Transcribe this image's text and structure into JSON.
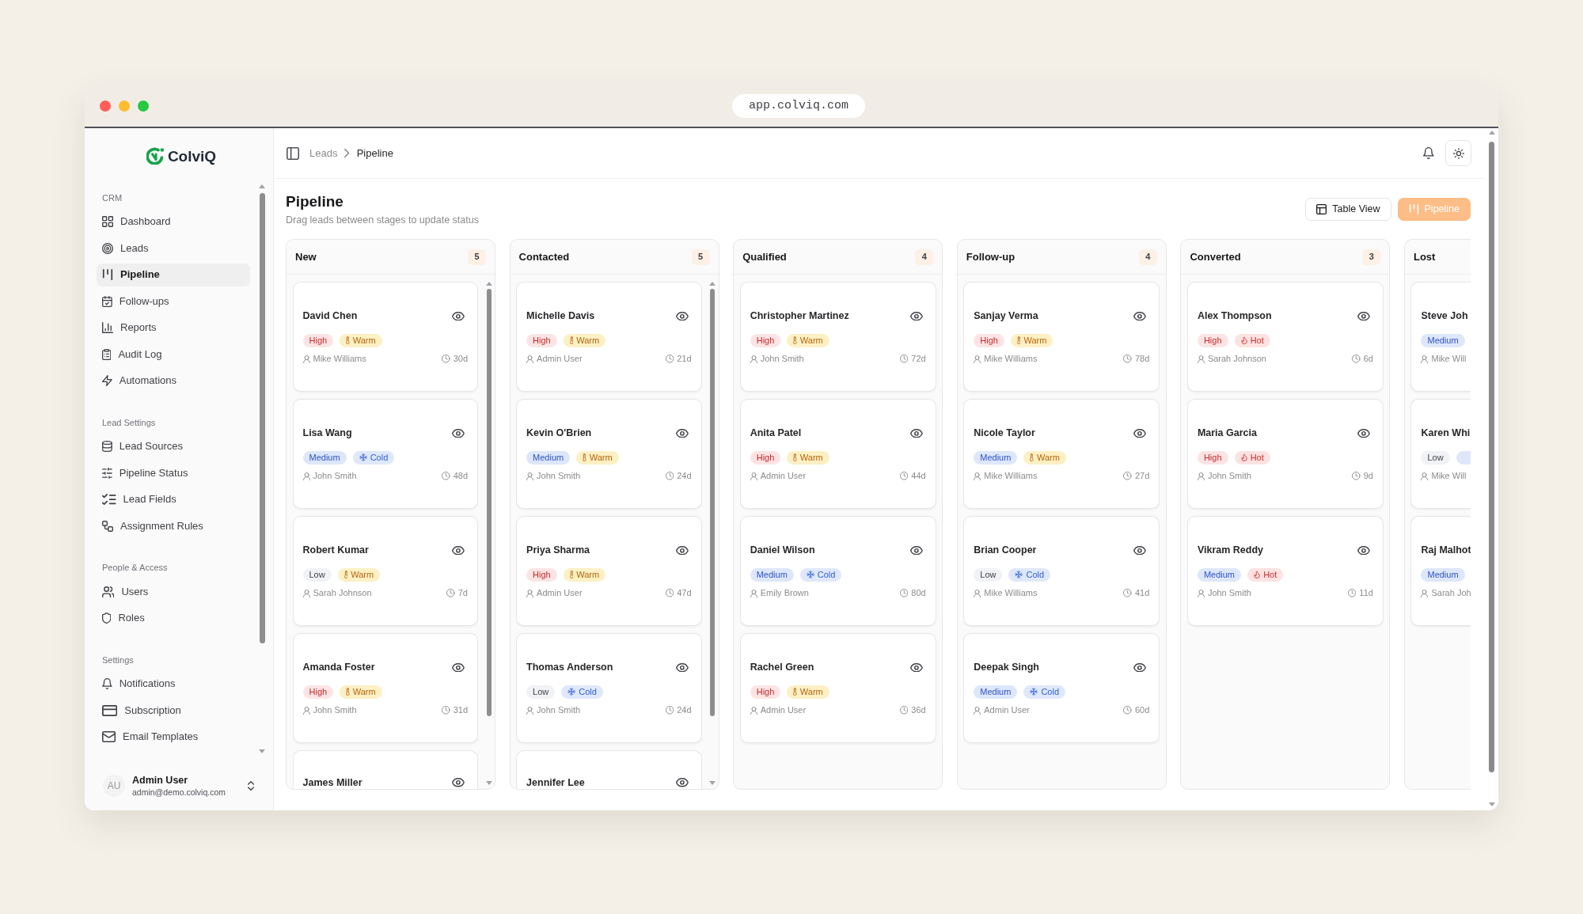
{
  "browser": {
    "url": "app.colviq.com"
  },
  "sidebar": {
    "brand": "ColviQ",
    "sections": [
      {
        "title": "CRM",
        "items": [
          {
            "label": "Dashboard",
            "selected": false
          },
          {
            "label": "Leads",
            "selected": false
          },
          {
            "label": "Pipeline",
            "selected": true
          },
          {
            "label": "Follow-ups",
            "selected": false
          },
          {
            "label": "Reports",
            "selected": false
          },
          {
            "label": "Audit Log",
            "selected": false
          },
          {
            "label": "Automations",
            "selected": false
          }
        ]
      },
      {
        "title": "Lead Settings",
        "items": [
          {
            "label": "Lead Sources",
            "selected": false
          },
          {
            "label": "Pipeline Status",
            "selected": false
          },
          {
            "label": "Lead Fields",
            "selected": false
          },
          {
            "label": "Assignment Rules",
            "selected": false
          }
        ]
      },
      {
        "title": "People & Access",
        "items": [
          {
            "label": "Users",
            "selected": false
          },
          {
            "label": "Roles",
            "selected": false
          }
        ]
      },
      {
        "title": "Settings",
        "items": [
          {
            "label": "Notifications",
            "selected": false
          },
          {
            "label": "Subscription",
            "selected": false
          },
          {
            "label": "Email Templates",
            "selected": false
          }
        ]
      }
    ],
    "user": {
      "initials": "AU",
      "name": "Admin User",
      "email": "admin@demo.colviq.com"
    }
  },
  "topbar": {
    "breadcrumb": [
      {
        "label": "Leads",
        "current": false
      },
      {
        "label": "Pipeline",
        "current": true
      }
    ]
  },
  "header": {
    "title": "Pipeline",
    "subtitle": "Drag leads between stages to update status",
    "view_buttons": [
      {
        "label": "Table View",
        "selected": false
      },
      {
        "label": "Pipeline",
        "selected": true
      }
    ]
  },
  "columns": [
    {
      "kind": "full",
      "title": "New",
      "count": "5",
      "cards": [
        {
          "name": "David Chen",
          "priority": {
            "kind": "high",
            "label": "High"
          },
          "temperature": {
            "kind": "warm",
            "label": "Warm"
          },
          "owner": "Mike Williams",
          "age": "30d"
        },
        {
          "name": "Lisa Wang",
          "priority": {
            "kind": "medium",
            "label": "Medium"
          },
          "temperature": {
            "kind": "cold",
            "label": "Cold"
          },
          "owner": "John Smith",
          "age": "48d"
        },
        {
          "name": "Robert Kumar",
          "priority": {
            "kind": "low",
            "label": "Low"
          },
          "temperature": {
            "kind": "warm",
            "label": "Warm"
          },
          "owner": "Sarah Johnson",
          "age": "7d"
        },
        {
          "name": "Amanda Foster",
          "priority": {
            "kind": "high",
            "label": "High"
          },
          "temperature": {
            "kind": "warm",
            "label": "Warm"
          },
          "owner": "John Smith",
          "age": "31d"
        },
        {
          "name": "James Miller"
        }
      ]
    },
    {
      "kind": "full",
      "title": "Contacted",
      "count": "5",
      "cards": [
        {
          "name": "Michelle Davis",
          "priority": {
            "kind": "high",
            "label": "High"
          },
          "temperature": {
            "kind": "warm",
            "label": "Warm"
          },
          "owner": "Admin User",
          "age": "21d"
        },
        {
          "name": "Kevin O'Brien",
          "priority": {
            "kind": "medium",
            "label": "Medium"
          },
          "temperature": {
            "kind": "warm",
            "label": "Warm"
          },
          "owner": "John Smith",
          "age": "24d"
        },
        {
          "name": "Priya Sharma",
          "priority": {
            "kind": "high",
            "label": "High"
          },
          "temperature": {
            "kind": "warm",
            "label": "Warm"
          },
          "owner": "Admin User",
          "age": "47d"
        },
        {
          "name": "Thomas Anderson",
          "priority": {
            "kind": "low",
            "label": "Low"
          },
          "temperature": {
            "kind": "cold",
            "label": "Cold"
          },
          "owner": "John Smith",
          "age": "24d"
        },
        {
          "name": "Jennifer Lee"
        }
      ]
    },
    {
      "kind": "full",
      "title": "Qualified",
      "count": "4",
      "cards": [
        {
          "name": "Christopher Martinez",
          "priority": {
            "kind": "high",
            "label": "High"
          },
          "temperature": {
            "kind": "warm",
            "label": "Warm"
          },
          "owner": "John Smith",
          "age": "72d"
        },
        {
          "name": "Anita Patel",
          "priority": {
            "kind": "high",
            "label": "High"
          },
          "temperature": {
            "kind": "warm",
            "label": "Warm"
          },
          "owner": "Admin User",
          "age": "44d"
        },
        {
          "name": "Daniel Wilson",
          "priority": {
            "kind": "medium",
            "label": "Medium"
          },
          "temperature": {
            "kind": "cold",
            "label": "Cold"
          },
          "owner": "Emily Brown",
          "age": "80d"
        },
        {
          "name": "Rachel Green",
          "priority": {
            "kind": "high",
            "label": "High"
          },
          "temperature": {
            "kind": "warm",
            "label": "Warm"
          },
          "owner": "Admin User",
          "age": "36d"
        }
      ]
    },
    {
      "kind": "full",
      "title": "Follow-up",
      "count": "4",
      "cards": [
        {
          "name": "Sanjay Verma",
          "priority": {
            "kind": "high",
            "label": "High"
          },
          "temperature": {
            "kind": "warm",
            "label": "Warm"
          },
          "owner": "Mike Williams",
          "age": "78d"
        },
        {
          "name": "Nicole Taylor",
          "priority": {
            "kind": "medium",
            "label": "Medium"
          },
          "temperature": {
            "kind": "warm",
            "label": "Warm"
          },
          "owner": "Mike Williams",
          "age": "27d"
        },
        {
          "name": "Brian Cooper",
          "priority": {
            "kind": "low",
            "label": "Low"
          },
          "temperature": {
            "kind": "cold",
            "label": "Cold"
          },
          "owner": "Mike Williams",
          "age": "41d"
        },
        {
          "name": "Deepak Singh",
          "priority": {
            "kind": "medium",
            "label": "Medium"
          },
          "temperature": {
            "kind": "cold",
            "label": "Cold"
          },
          "owner": "Admin User",
          "age": "60d"
        }
      ]
    },
    {
      "kind": "full",
      "title": "Converted",
      "count": "3",
      "cards": [
        {
          "name": "Alex Thompson",
          "priority": {
            "kind": "high",
            "label": "High"
          },
          "temperature": {
            "kind": "hot",
            "label": "Hot"
          },
          "owner": "Sarah Johnson",
          "age": "6d"
        },
        {
          "name": "Maria Garcia",
          "priority": {
            "kind": "high",
            "label": "High"
          },
          "temperature": {
            "kind": "hot",
            "label": "Hot"
          },
          "owner": "John Smith",
          "age": "9d"
        },
        {
          "name": "Vikram Reddy",
          "priority": {
            "kind": "medium",
            "label": "Medium"
          },
          "temperature": {
            "kind": "hot",
            "label": "Hot"
          },
          "owner": "John Smith",
          "age": "11d"
        }
      ]
    },
    {
      "kind": "clipped",
      "title": "Lost",
      "cards": [
        {
          "name": "Steve Joh",
          "priority": {
            "kind": "medium",
            "label": "Medium"
          },
          "owner": "Mike Will"
        },
        {
          "name": "Karen Whi",
          "priority": {
            "kind": "low",
            "label": "Low"
          },
          "temperature": {
            "kind": "cold"
          },
          "owner": "Mike Will"
        },
        {
          "name": "Raj Malhot",
          "priority": {
            "kind": "medium",
            "label": "Medium"
          },
          "owner": "Sarah Joh"
        }
      ]
    }
  ]
}
